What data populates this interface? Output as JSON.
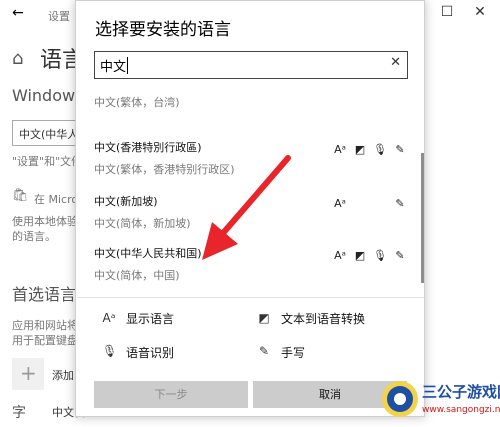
{
  "window": {
    "back_icon": "back-arrow-icon",
    "title": "设置",
    "home_icon": "home-icon",
    "heading": "语言",
    "windows_label": "Windows",
    "display_lang_value": "中文(中华人",
    "desc_line": "\"设置\"和\"文件",
    "store_link": "在 Micro",
    "store_desc_1": "使用本地体验",
    "store_desc_2": "的语言。",
    "preferred_heading": "首选语言",
    "preferred_desc_1": "应用和网站将",
    "preferred_desc_2": "用于配置键盘",
    "add_label": "添加",
    "lang_item": "中文(中"
  },
  "dialog": {
    "title": "选择要安装的语言",
    "search": {
      "value": "中文",
      "clear_icon": "clear-x-icon"
    },
    "languages": [
      {
        "name": "",
        "subname": "中文(繁体，台湾)",
        "capabilities": [
          "text-to-speech",
          "speech",
          "handwriting",
          "display-language"
        ]
      },
      {
        "name": "中文(香港特別行政區)",
        "subname": "中文(繁体，香港特别行政区)",
        "capabilities": [
          "display-language",
          "text-to-speech",
          "speech",
          "handwriting"
        ]
      },
      {
        "name": "中文(新加坡)",
        "subname": "中文(简体，新加坡)",
        "capabilities": [
          "display-language",
          "handwriting"
        ]
      },
      {
        "name": "中文(中华人民共和国)",
        "subname": "中文(简体，中国)",
        "capabilities": [
          "display-language",
          "text-to-speech",
          "speech",
          "handwriting"
        ]
      }
    ],
    "features": {
      "display_language": "显示语言",
      "text_to_speech": "文本到语音转换",
      "speech_recognition": "语音识别",
      "handwriting": "手写"
    },
    "buttons": {
      "next": "下一步",
      "cancel": "取消"
    }
  },
  "watermark": {
    "title": "三公子游戏网",
    "url": "www.sangongzi.net"
  },
  "colors": {
    "arrow": "#e8252a",
    "button_bg": "#cccccc",
    "watermark_blue": "#1f4fa3",
    "watermark_red": "#dd1111"
  }
}
